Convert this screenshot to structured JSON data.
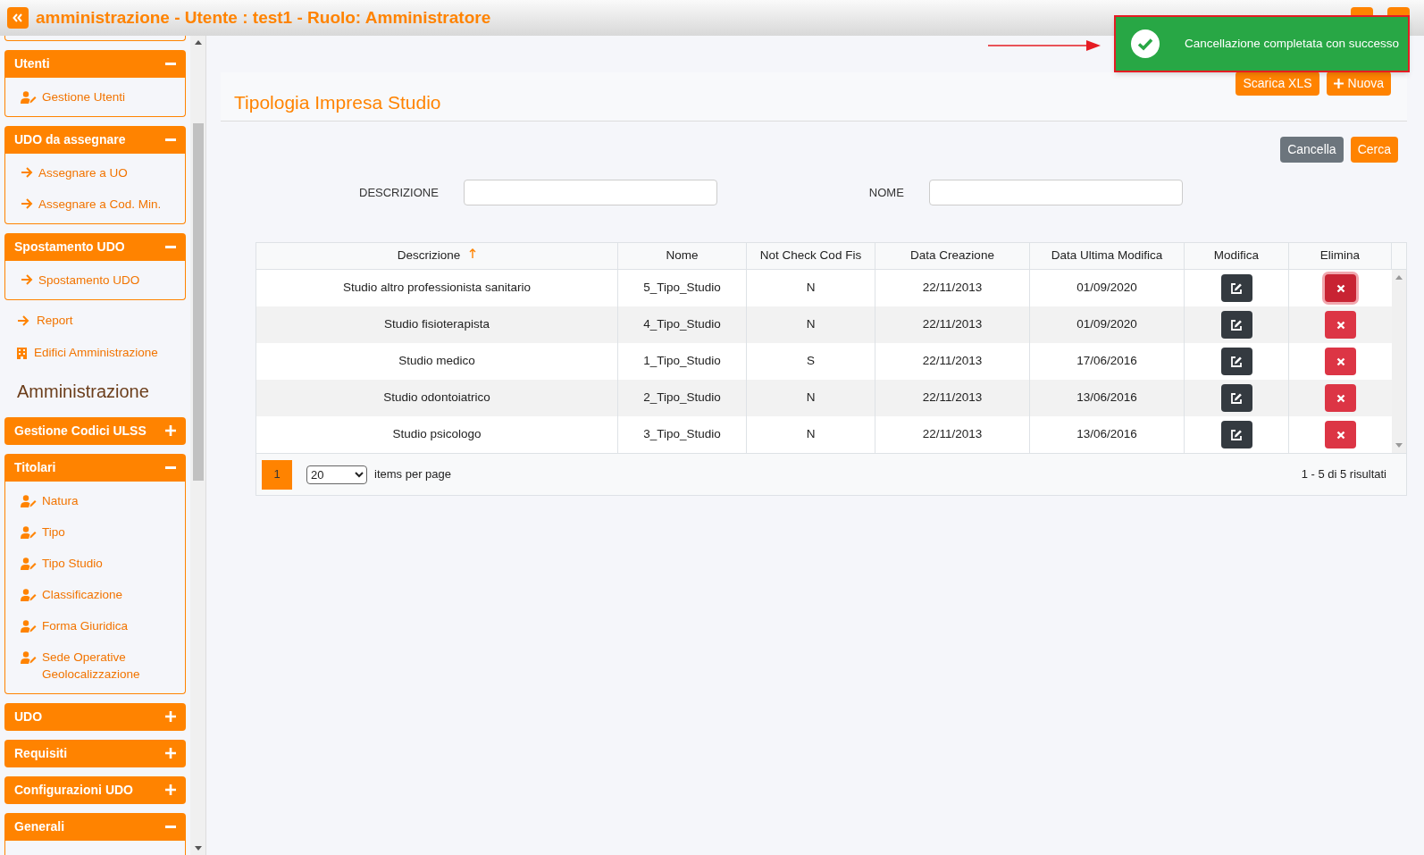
{
  "header": {
    "title": "amministrazione - Utente : test1 - Ruolo: Amministratore"
  },
  "sidebar": [
    {
      "kind": "stub"
    },
    {
      "kind": "group",
      "label": "Utenti",
      "expanded": true,
      "items": [
        {
          "label": "Gestione Utenti",
          "kind": "user"
        }
      ]
    },
    {
      "kind": "group",
      "label": "UDO da assegnare",
      "expanded": true,
      "items": [
        {
          "label": "Assegnare a UO",
          "kind": "arrow"
        },
        {
          "label": "Assegnare a Cod. Min.",
          "kind": "arrow"
        }
      ]
    },
    {
      "kind": "group",
      "label": "Spostamento UDO",
      "expanded": true,
      "items": [
        {
          "label": "Spostamento UDO",
          "kind": "arrow"
        }
      ]
    },
    {
      "kind": "link",
      "label": "Report"
    },
    {
      "kind": "building",
      "label": "Edifici Amministrazione"
    },
    {
      "kind": "heading",
      "label": "Amministrazione"
    },
    {
      "kind": "group",
      "label": "Gestione Codici ULSS",
      "expanded": false
    },
    {
      "kind": "group",
      "label": "Titolari",
      "expanded": true,
      "items": [
        {
          "label": "Natura",
          "kind": "user"
        },
        {
          "label": "Tipo",
          "kind": "user"
        },
        {
          "label": "Tipo Studio",
          "kind": "user"
        },
        {
          "label": "Classificazione",
          "kind": "user"
        },
        {
          "label": "Forma Giuridica",
          "kind": "user"
        },
        {
          "label": "Sede Operative Geolocalizzazione",
          "kind": "user"
        }
      ]
    },
    {
      "kind": "group",
      "label": "UDO",
      "expanded": false
    },
    {
      "kind": "group",
      "label": "Requisiti",
      "expanded": false
    },
    {
      "kind": "group",
      "label": "Configurazioni UDO",
      "expanded": false
    },
    {
      "kind": "group",
      "label": "Generali",
      "expanded": true
    }
  ],
  "toast": {
    "message": "Cancellazione completata con successo"
  },
  "page": {
    "title": "Tipologia Impresa Studio",
    "buttons": [
      {
        "label": "Scarica XLS",
        "kind": "plain"
      },
      {
        "label": "Nuova",
        "kind": "add"
      }
    ]
  },
  "filters": {
    "buttons": [
      {
        "label": "Cancella",
        "kind": "secondary"
      },
      {
        "label": "Cerca",
        "kind": "primary"
      }
    ],
    "fields": [
      {
        "label": "DESCRIZIONE"
      },
      {
        "label": "NOME"
      }
    ]
  },
  "table": {
    "columns": [
      {
        "label": "Descrizione",
        "sorted": true
      },
      {
        "label": "Nome",
        "sorted": false
      },
      {
        "label": "Not Check Cod Fis",
        "sorted": false
      },
      {
        "label": "Data Creazione",
        "sorted": false
      },
      {
        "label": "Data Ultima Modifica",
        "sorted": false
      },
      {
        "label": "Modifica",
        "sorted": false
      },
      {
        "label": "Elimina",
        "sorted": false
      }
    ],
    "rows": [
      {
        "cells": [
          "Studio altro professionista sanitario",
          "5_Tipo_Studio",
          "N",
          "22/11/2013",
          "01/09/2020"
        ],
        "focused": true
      },
      {
        "cells": [
          "Studio fisioterapista",
          "4_Tipo_Studio",
          "N",
          "22/11/2013",
          "01/09/2020"
        ],
        "focused": false
      },
      {
        "cells": [
          "Studio medico",
          "1_Tipo_Studio",
          "S",
          "22/11/2013",
          "17/06/2016"
        ],
        "focused": false
      },
      {
        "cells": [
          "Studio odontoiatrico",
          "2_Tipo_Studio",
          "N",
          "22/11/2013",
          "13/06/2016"
        ],
        "focused": false
      },
      {
        "cells": [
          "Studio psicologo",
          "3_Tipo_Studio",
          "N",
          "22/11/2013",
          "13/06/2016"
        ],
        "focused": false
      }
    ]
  },
  "pager": {
    "pages": [
      {
        "label": "1",
        "selected": true
      }
    ],
    "page_size": "20",
    "page_size_label": "items per page",
    "summary": "1 - 5 di 5 risultati"
  }
}
